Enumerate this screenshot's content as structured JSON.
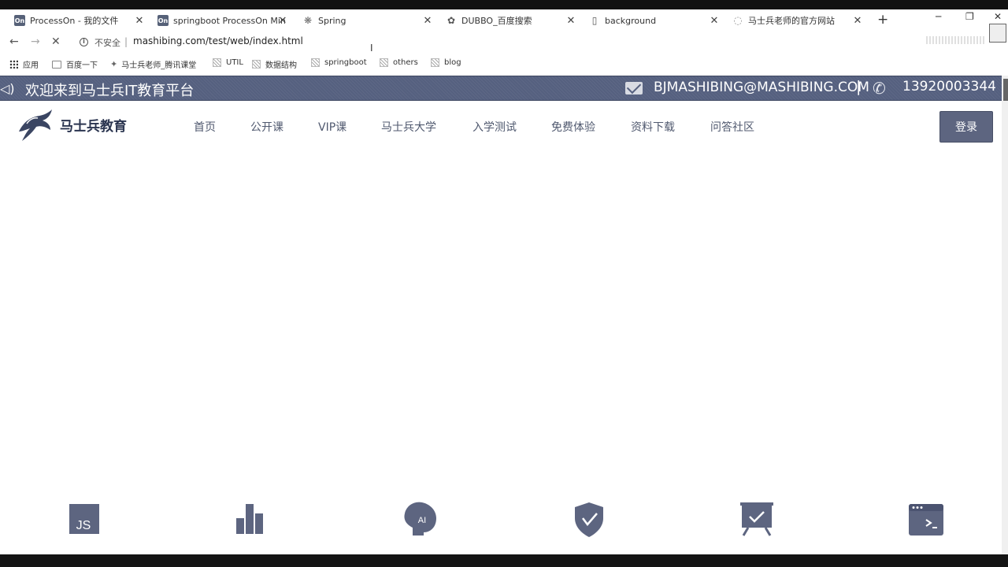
{
  "browser": {
    "tabs": [
      {
        "title": "ProcessOn - 我的文件",
        "favicon": "On"
      },
      {
        "title": "springboot ProcessOn Min",
        "favicon": "On"
      },
      {
        "title": "Spring",
        "favicon": "spring-icon"
      },
      {
        "title": "DUBBO_百度搜索",
        "favicon": "paw-icon"
      },
      {
        "title": "background",
        "favicon": "doc-icon"
      },
      {
        "title": "马士兵老师的官方网站",
        "favicon": "loading-icon"
      }
    ],
    "new_tab": "+",
    "window_controls": {
      "minimize": "─",
      "restore": "❐",
      "close": "✕"
    },
    "address": {
      "security_label": "不安全",
      "separator": "|",
      "url": "mashibing.com/test/web/index.html"
    },
    "bookmarks": [
      {
        "label": "应用",
        "icon": "apps-icon"
      },
      {
        "label": "百度一下",
        "icon": "folder-icon"
      },
      {
        "label": "马士兵老师_腾讯课堂",
        "icon": "star-icon"
      },
      {
        "label": "UTIL",
        "icon": "folder-icon"
      },
      {
        "label": "数据结构",
        "icon": "folder-icon"
      },
      {
        "label": "springboot",
        "icon": "folder-icon"
      },
      {
        "label": "others",
        "icon": "folder-icon"
      },
      {
        "label": "blog",
        "icon": "folder-icon"
      }
    ]
  },
  "site": {
    "banner": {
      "welcome": "欢迎来到马士兵IT教育平台",
      "email": "BJMASHIBING@MASHIBING.COM",
      "divider": "|",
      "phone": "13920003344"
    },
    "logo_text": "马士兵教育",
    "nav": [
      "首页",
      "公开课",
      "VIP课",
      "马士兵大学",
      "入学测试",
      "免费体验",
      "资料下载",
      "问答社区"
    ],
    "login_label": "登录",
    "features": [
      {
        "icon": "js-icon",
        "label": "JS"
      },
      {
        "icon": "bar-chart-icon"
      },
      {
        "icon": "ai-head-icon",
        "label": "AI"
      },
      {
        "icon": "shield-icon"
      },
      {
        "icon": "presentation-icon"
      },
      {
        "icon": "code-window-icon"
      }
    ]
  },
  "colors": {
    "banner_bg": "#55607f",
    "accent": "#5d6580",
    "nav_text": "#50596f"
  }
}
